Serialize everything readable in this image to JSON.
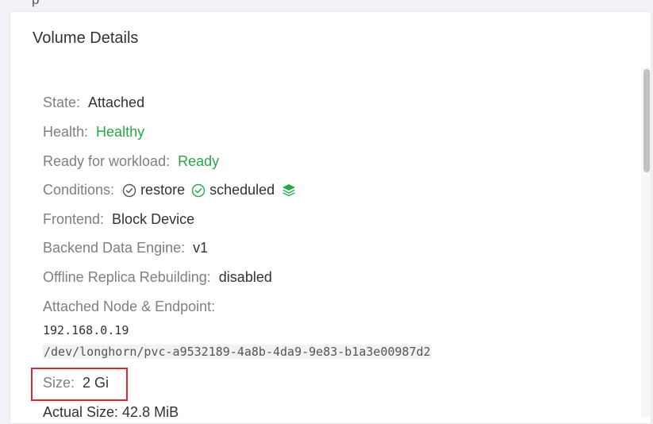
{
  "header": {
    "cut_text": "p"
  },
  "card": {
    "title": "Volume Details"
  },
  "details": {
    "state_label": "State:",
    "state_value": "Attached",
    "health_label": "Health:",
    "health_value": "Healthy",
    "ready_label": "Ready for workload:",
    "ready_value": "Ready",
    "conditions_label": "Conditions:",
    "conditions": [
      {
        "icon": "check-circle-icon",
        "label": "restore"
      },
      {
        "icon": "check-circle-icon",
        "label": "scheduled"
      }
    ],
    "frontend_label": "Frontend:",
    "frontend_value": "Block Device",
    "backend_label": "Backend Data Engine:",
    "backend_value": "v1",
    "offline_label": "Offline Replica Rebuilding:",
    "offline_value": "disabled",
    "attached_label": "Attached Node & Endpoint:",
    "node_ip": "192.168.0.19",
    "endpoint": "/dev/longhorn/pvc-a9532189-4a8b-4da9-9e83-b1a3e00987d2",
    "size_label": "Size:",
    "size_value": "2 Gi",
    "next_row_partial": "Actual Size:  42.8 MiB"
  },
  "colors": {
    "green": "#27a745",
    "highlight_border": "#e0262f",
    "label_gray": "#7f7f7f"
  }
}
